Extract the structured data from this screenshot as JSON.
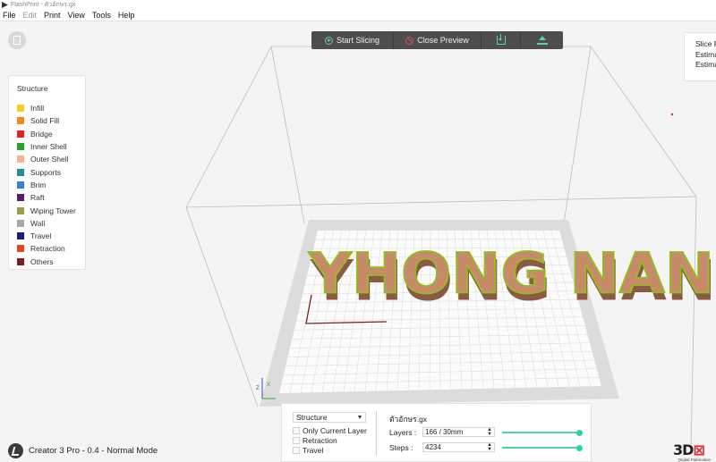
{
  "window": {
    "title": "FlashPrint - ตัวอักษร.gx"
  },
  "menu": {
    "items": [
      {
        "label": "File",
        "enabled": true
      },
      {
        "label": "Edit",
        "enabled": false
      },
      {
        "label": "Print",
        "enabled": true
      },
      {
        "label": "View",
        "enabled": true
      },
      {
        "label": "Tools",
        "enabled": true
      },
      {
        "label": "Help",
        "enabled": true
      }
    ]
  },
  "toolbar": {
    "start_slicing": "Start Slicing",
    "close_preview": "Close Preview",
    "download_icon": "download-icon",
    "upload_icon": "upload-icon"
  },
  "legend": {
    "title": "Structure",
    "items": [
      {
        "label": "Infill",
        "color": "#f2d21b"
      },
      {
        "label": "Solid Fill",
        "color": "#f08a1e"
      },
      {
        "label": "Bridge",
        "color": "#e02424"
      },
      {
        "label": "Inner Shell",
        "color": "#22a32a"
      },
      {
        "label": "Outer Shell",
        "color": "#f3b58f"
      },
      {
        "label": "Supports",
        "color": "#1f8f8f"
      },
      {
        "label": "Brim",
        "color": "#3c7ddc"
      },
      {
        "label": "Raft",
        "color": "#5a1a6e"
      },
      {
        "label": "Wiping Tower",
        "color": "#9a9a48"
      },
      {
        "label": "Wall",
        "color": "#a8a8a8"
      },
      {
        "label": "Travel",
        "color": "#1c1c7a"
      },
      {
        "label": "Retraction",
        "color": "#e04a1a"
      },
      {
        "label": "Others",
        "color": "#7a1f1f"
      }
    ]
  },
  "info_panel": {
    "lines": [
      "Slice F",
      "Estima",
      "Estima"
    ]
  },
  "model": {
    "text": "YHONG NAN",
    "wall_color": "#c98a6c",
    "edge_color": "#8fbf1a"
  },
  "preview_panel": {
    "structure_select": "Structure",
    "only_current_layer": "Only Current Layer",
    "retraction": "Retraction",
    "travel": "Travel",
    "file_name": "ตัวอักษร.gx",
    "layers_label": "Layers :",
    "layers_value": "166 / 30mm",
    "layers_fraction": 1.0,
    "steps_label": "Steps :",
    "steps_value": "4234",
    "steps_fraction": 1.0
  },
  "status": {
    "machine": "Creator 3 Pro - 0.4 - Normal Mode"
  },
  "brand": {
    "mark": "3D",
    "sub": "Digital Fabrication"
  },
  "axis": {
    "x_label": "X",
    "z_label": "Z"
  }
}
